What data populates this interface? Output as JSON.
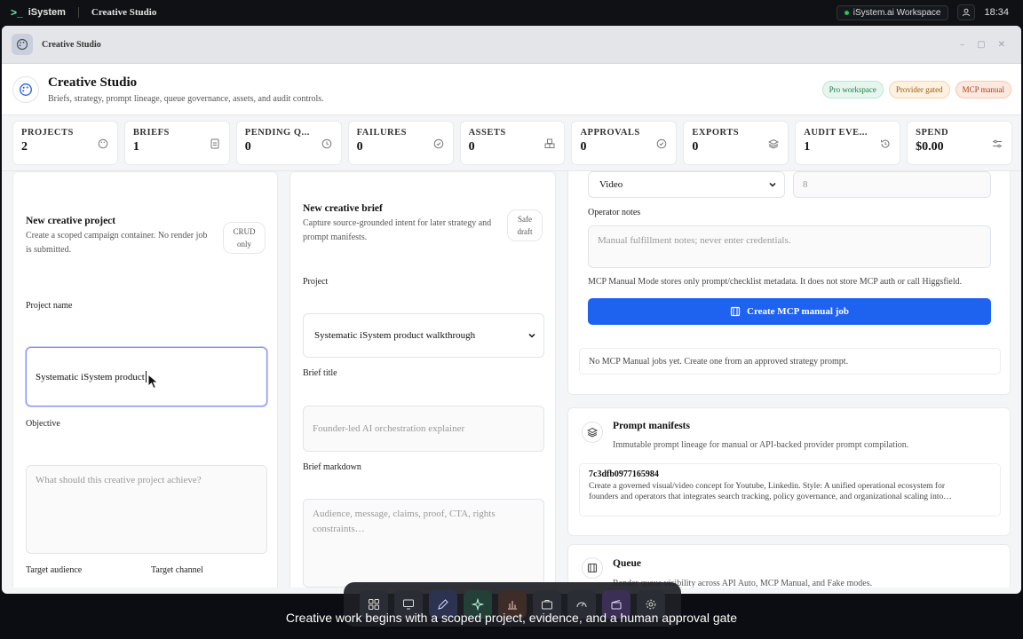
{
  "system_bar": {
    "brand": "iSystem",
    "app": "Creative Studio",
    "workspace": "iSystem.ai Workspace",
    "time": "18:34"
  },
  "window": {
    "title": "Creative Studio",
    "controls": [
      "–",
      "▢",
      "✕"
    ]
  },
  "header": {
    "title": "Creative Studio",
    "subtitle": "Briefs, strategy, prompt lineage, queue governance, assets, and audit controls.",
    "badges": [
      "Pro workspace",
      "Provider gated",
      "MCP manual"
    ]
  },
  "stats": [
    {
      "label": "PROJECTS",
      "value": "2",
      "icon": "palette-icon"
    },
    {
      "label": "BRIEFS",
      "value": "1",
      "icon": "document-icon"
    },
    {
      "label": "PENDING Q...",
      "value": "0",
      "icon": "clock-icon"
    },
    {
      "label": "FAILURES",
      "value": "0",
      "icon": "check-circle-icon"
    },
    {
      "label": "ASSETS",
      "value": "0",
      "icon": "boxes-icon"
    },
    {
      "label": "APPROVALS",
      "value": "0",
      "icon": "check-circle-icon"
    },
    {
      "label": "EXPORTS",
      "value": "0",
      "icon": "layers-icon"
    },
    {
      "label": "AUDIT EVE...",
      "value": "1",
      "icon": "history-icon"
    },
    {
      "label": "SPEND",
      "value": "$0.00",
      "icon": "sliders-icon"
    }
  ],
  "project_card": {
    "title": "New creative project",
    "subtitle": "Create a scoped campaign container. No render job is submitted.",
    "pill": "CRUD only",
    "name_label": "Project name",
    "name_value": "Systematic iSystem product",
    "objective_label": "Objective",
    "objective_placeholder": "What should this creative project achieve?",
    "audience_label": "Target audience",
    "channel_label": "Target channel"
  },
  "brief_card": {
    "title": "New creative brief",
    "subtitle": "Capture source-grounded intent for later strategy and prompt manifests.",
    "pill": "Safe draft",
    "project_label": "Project",
    "project_value": "Systematic iSystem product walkthrough",
    "title_label": "Brief title",
    "title_placeholder": "Founder-led AI orchestration explainer",
    "markdown_label": "Brief markdown",
    "markdown_placeholder": "Audience, message, claims, proof, CTA, rights constraints…"
  },
  "mcp_card": {
    "media_select": "Video",
    "count_placeholder": "8",
    "notes_label": "Operator notes",
    "notes_placeholder": "Manual fulfillment notes; never enter credentials.",
    "info": "MCP Manual Mode stores only prompt/checklist metadata. It does not store MCP auth or call Higgsfield.",
    "button": "Create MCP manual job",
    "empty": "No MCP Manual jobs yet. Create one from an approved strategy prompt."
  },
  "manifests": {
    "title": "Prompt manifests",
    "subtitle": "Immutable prompt lineage for manual or API-backed provider prompt compilation.",
    "hash": "7c3dfb0977165984",
    "desc_line1": "Create a governed visual/video concept for Youtube, Linkedin. Style: A unified operational ecosystem for",
    "desc_line2": "founders and operators that integrates search tracking, policy governance, and organizational scaling into…"
  },
  "queue": {
    "title": "Queue",
    "subtitle": "Render queue visibility across API Auto, MCP Manual, and Fake modes."
  },
  "dock": [
    "grid-icon",
    "monitor-icon",
    "pen-icon",
    "sparkle-icon",
    "chart-icon",
    "briefcase-icon",
    "gauge-icon",
    "clapper-icon",
    "gear-icon"
  ],
  "caption": "Creative work begins with a scoped project, evidence, and a human approval gate",
  "colors": {
    "accent": "#1e62f0",
    "focus": "#7c8cf8"
  }
}
